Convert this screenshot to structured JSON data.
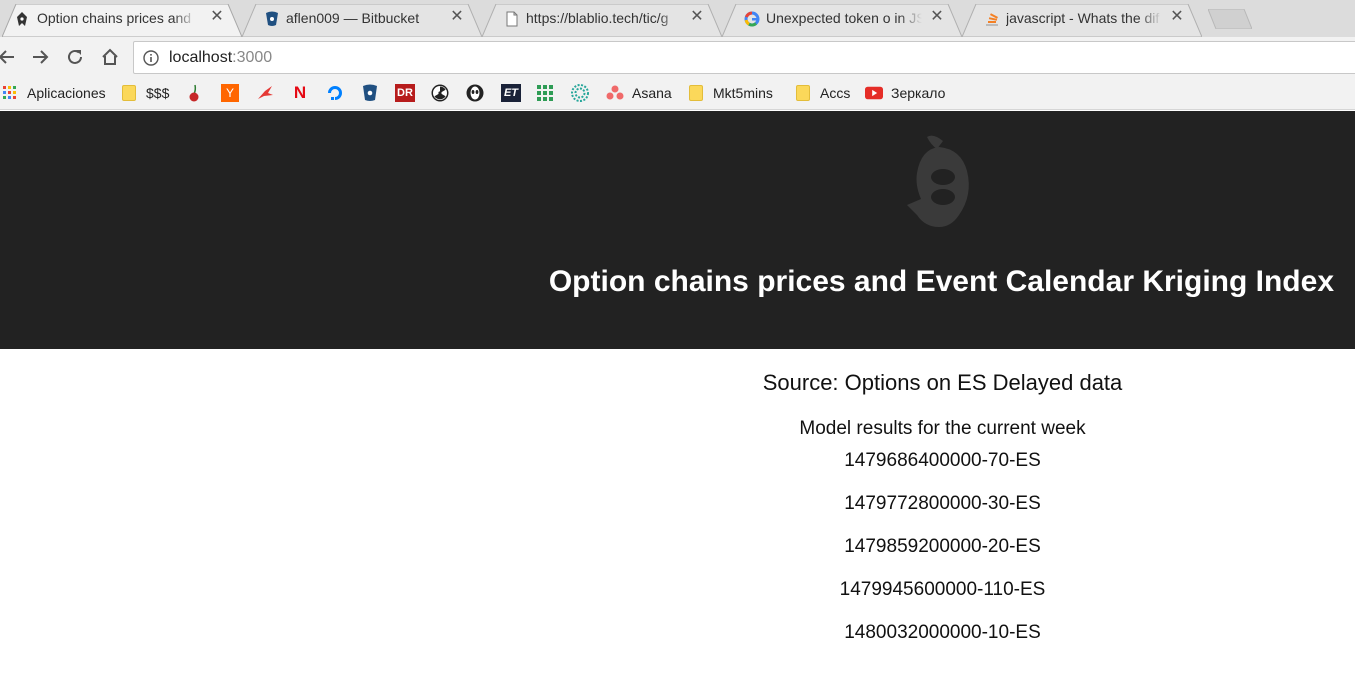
{
  "browser": {
    "tabs": [
      {
        "title": "Option chains prices and",
        "favicon": "react-logo-icon",
        "active": true
      },
      {
        "title": "aflen009 — Bitbucket",
        "favicon": "bitbucket-icon",
        "active": false
      },
      {
        "title": "https://blablio.tech/tic/g",
        "favicon": "page-icon",
        "active": false
      },
      {
        "title": "Unexpected token o in JS",
        "favicon": "google-icon",
        "active": false
      },
      {
        "title": "javascript - Whats the dif",
        "favicon": "stackoverflow-icon",
        "active": false
      }
    ],
    "close_glyph": "✕",
    "address_host": "localhost",
    "address_port": ":3000",
    "bookmarks": [
      {
        "label": "Aplicaciones",
        "icon": "apps-grid-icon"
      },
      {
        "label": "$$$",
        "icon": "folder-icon"
      },
      {
        "label": "",
        "icon": "cherry-icon"
      },
      {
        "label": "Y",
        "icon": "ycombinator-icon"
      },
      {
        "label": "",
        "icon": "red-bird-icon"
      },
      {
        "label": "N",
        "icon": "netflix-icon"
      },
      {
        "label": "",
        "icon": "digitalocean-icon"
      },
      {
        "label": "",
        "icon": "bitbucket-icon"
      },
      {
        "label": "DR",
        "icon": "dr-icon"
      },
      {
        "label": "",
        "icon": "radiation-icon"
      },
      {
        "label": "",
        "icon": "alien-icon"
      },
      {
        "label": "ET",
        "icon": "et-icon"
      },
      {
        "label": "",
        "icon": "green-grid-icon"
      },
      {
        "label": "",
        "icon": "teal-sphere-icon"
      },
      {
        "label": "Asana",
        "icon": "asana-icon"
      },
      {
        "label": "Mkt5mins",
        "icon": "folder-icon"
      },
      {
        "label": "Accs",
        "icon": "folder-icon"
      },
      {
        "label": "Зеркало",
        "icon": "youtube-icon"
      }
    ]
  },
  "page": {
    "title": "Option chains prices and Event Calendar Kriging Index",
    "source": "Source: Options on ES Delayed data",
    "subtitle": "Model results for the current week",
    "results": [
      "1479686400000-70-ES",
      "1479772800000-30-ES",
      "1479859200000-20-ES",
      "1479945600000-110-ES",
      "1480032000000-10-ES"
    ]
  },
  "colors": {
    "hero_bg": "#222222",
    "hero_text": "#ffffff",
    "body_text": "#111111"
  }
}
